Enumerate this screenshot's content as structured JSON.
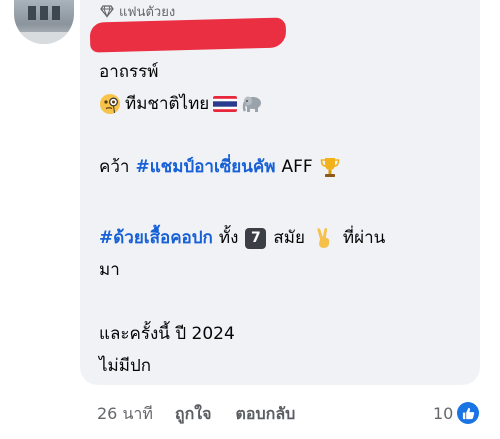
{
  "comment": {
    "badge": "แฟนตัวยง",
    "author": "",
    "lines": {
      "l1": "อาถรรพ์",
      "l2": "ทีมชาติไทย",
      "l3_prefix": "คว้า",
      "l3_hashtag": "#แชมป์อาเซี่ยนคัพ",
      "l3_suffix": "AFF",
      "l4_hashtag": "#ด้วยเสื้อคอปก",
      "l4_mid": "ทั้ง",
      "l4_number": "7",
      "l4_after": "สมัย",
      "l4_end": "ที่ผ่าน",
      "l5": "มา",
      "l6": "และครั้งนี้ ปี 2024",
      "l7": "ไม่มีปก"
    }
  },
  "meta": {
    "time": "26 นาที",
    "like_label": "ถูกใจ",
    "reply_label": "ตอบกลับ",
    "reaction_count": "10"
  },
  "icons": {
    "badge": "diamond-icon",
    "l2_a": "monocle-face-icon",
    "l2_b": "thailand-flag-icon",
    "l2_c": "elephant-icon",
    "l3": "trophy-icon",
    "l4_number": "keycap-icon",
    "l4_hand": "victory-hand-icon",
    "reaction": "like-icon"
  },
  "colors": {
    "hashtag": "#1760d6",
    "bubble": "#f0f2f5",
    "redaction": "#ea2f43",
    "meta": "#65676b",
    "like": "#1b74e4"
  }
}
